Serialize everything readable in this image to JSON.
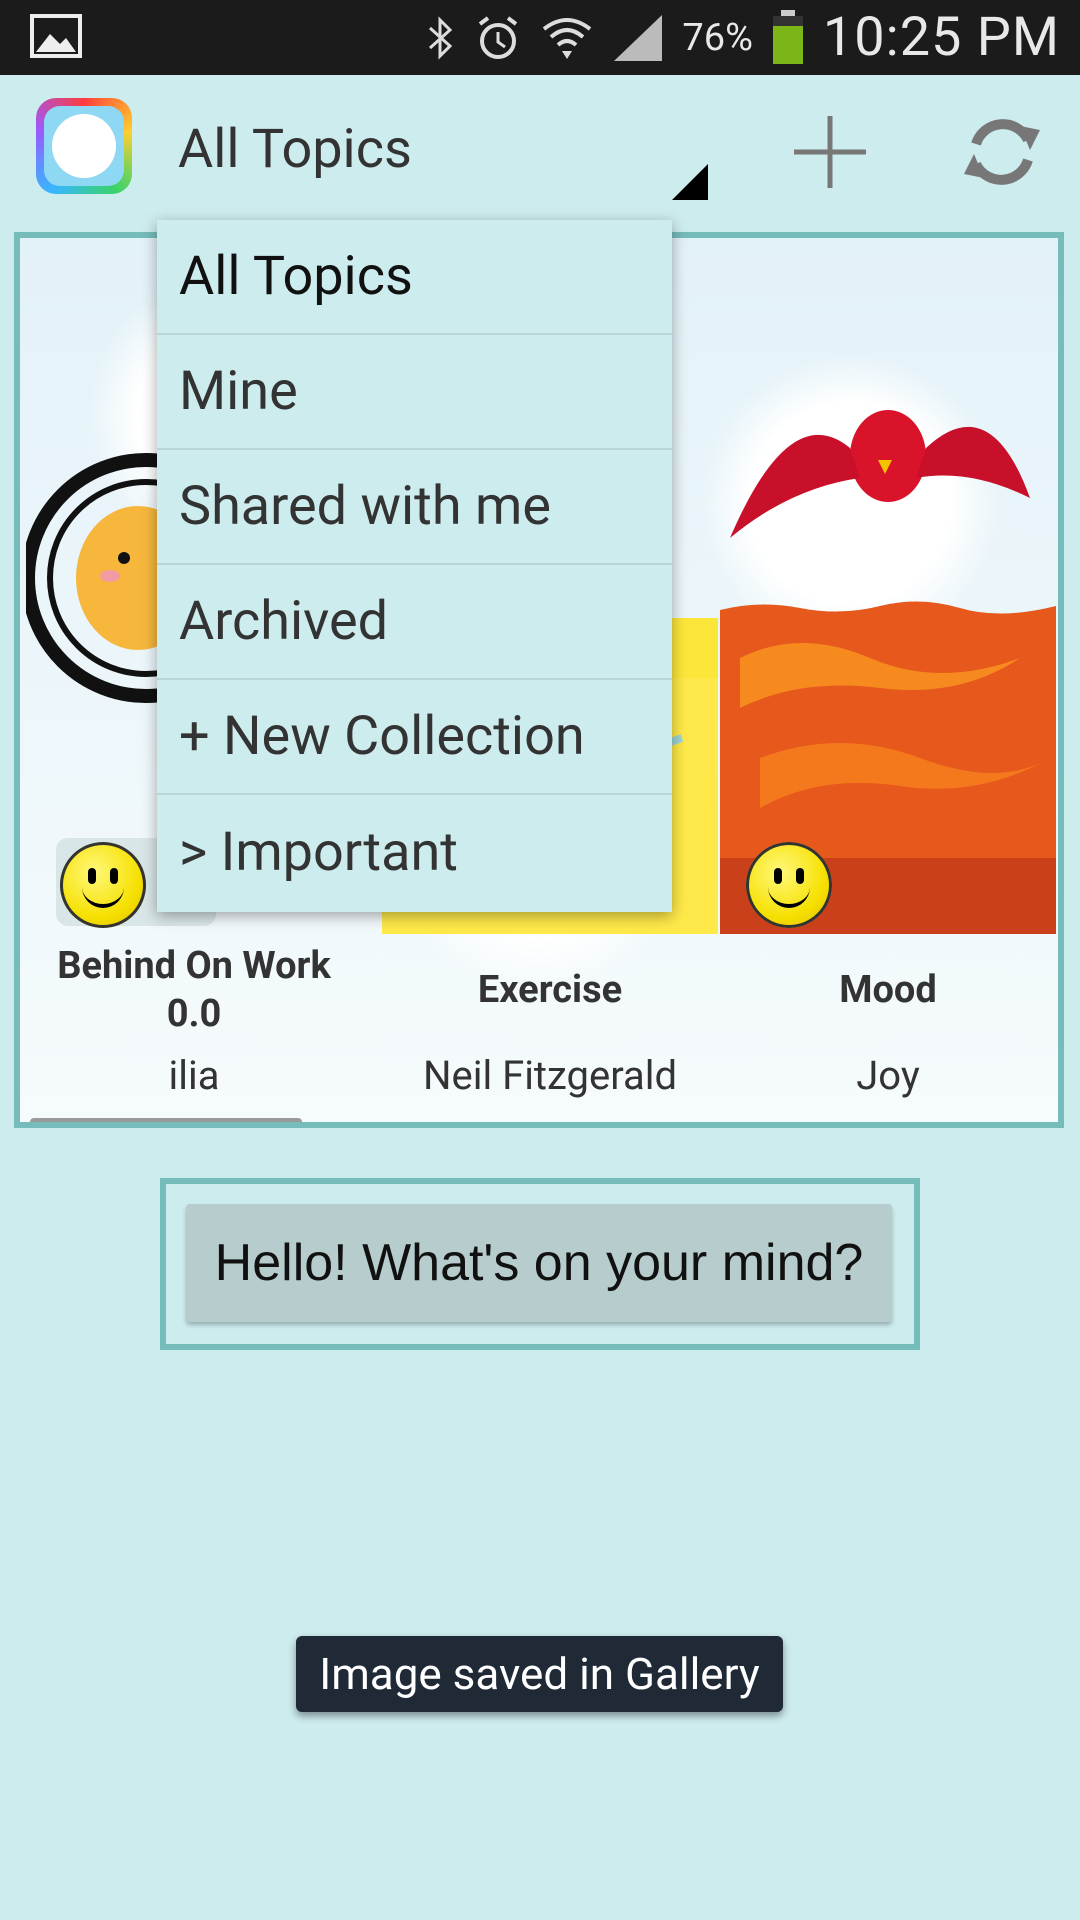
{
  "status_bar": {
    "battery_pct": "76%",
    "time": "10:25 PM",
    "icons": [
      "gallery-icon",
      "bluetooth-icon",
      "alarm-icon",
      "wifi-icon",
      "signal-icon",
      "battery-icon"
    ]
  },
  "action_bar": {
    "title": "All Topics",
    "actions": [
      "add-icon",
      "refresh-icon"
    ]
  },
  "dropdown": {
    "items": [
      {
        "label": "All Topics",
        "selected": true
      },
      {
        "label": "Mine"
      },
      {
        "label": "Shared with me"
      },
      {
        "label": "Archived"
      },
      {
        "label": "+ New Collection"
      },
      {
        "label": "> Important"
      }
    ]
  },
  "cards": [
    {
      "title": "Behind On Work",
      "score": "0.0",
      "owner": "ilia"
    },
    {
      "title": "Exercise",
      "owner": "Neil Fitzgerald"
    },
    {
      "title": "Mood",
      "owner": "Joy"
    }
  ],
  "compose": {
    "label": "Hello! What's on your mind?"
  },
  "toast": {
    "text": "Image saved in Gallery"
  },
  "colors": {
    "background": "#cdecee",
    "border": "#76bcbb",
    "toast": "#1f2a36"
  }
}
